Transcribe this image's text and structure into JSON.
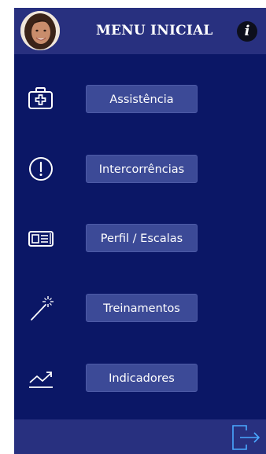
{
  "header": {
    "title": "MENU INICIAL",
    "info_label": "i",
    "avatar_icon": "user-avatar"
  },
  "menu": {
    "items": [
      {
        "label": "Assistência",
        "icon": "first-aid-kit-icon"
      },
      {
        "label": "Intercorrências",
        "icon": "alert-circle-icon"
      },
      {
        "label": "Perfil / Escalas",
        "icon": "newspaper-icon"
      },
      {
        "label": "Treinamentos",
        "icon": "magic-wand-icon"
      },
      {
        "label": "Indicadores",
        "icon": "trending-up-icon"
      }
    ]
  },
  "footer": {
    "logout_icon": "logout-icon"
  },
  "colors": {
    "background": "#0b1766",
    "header": "#28307f",
    "button": "#3c4a97",
    "text": "#ffffff"
  }
}
